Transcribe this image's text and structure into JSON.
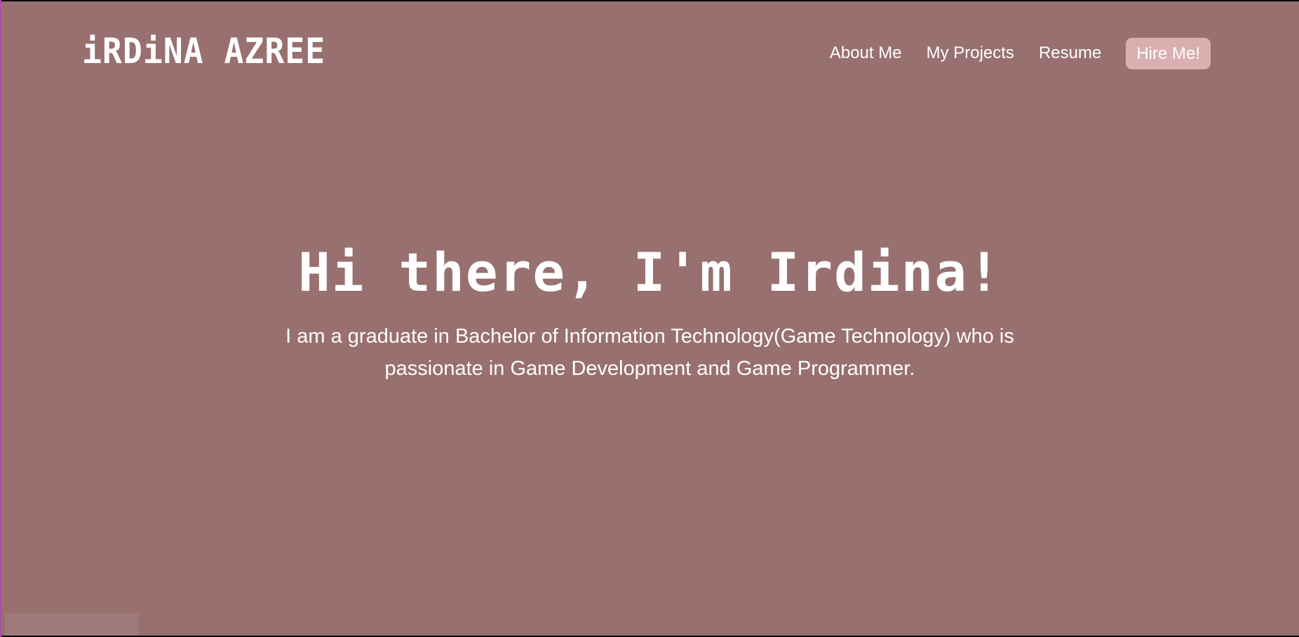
{
  "header": {
    "logo_text": "iRDiNA AZREE",
    "nav_items": [
      {
        "label": "About Me"
      },
      {
        "label": "My Projects"
      },
      {
        "label": "Resume"
      }
    ],
    "cta_label": "Hire Me!"
  },
  "hero": {
    "title": "Hi there, I'm Irdina!",
    "subtitle": "I am a graduate in Bachelor of Information Technology(Game Technology) who is passionate in Game Development and Game Programmer."
  },
  "colors": {
    "background": "#987070",
    "cta_background": "#dbafaf",
    "text": "#ffffff"
  }
}
